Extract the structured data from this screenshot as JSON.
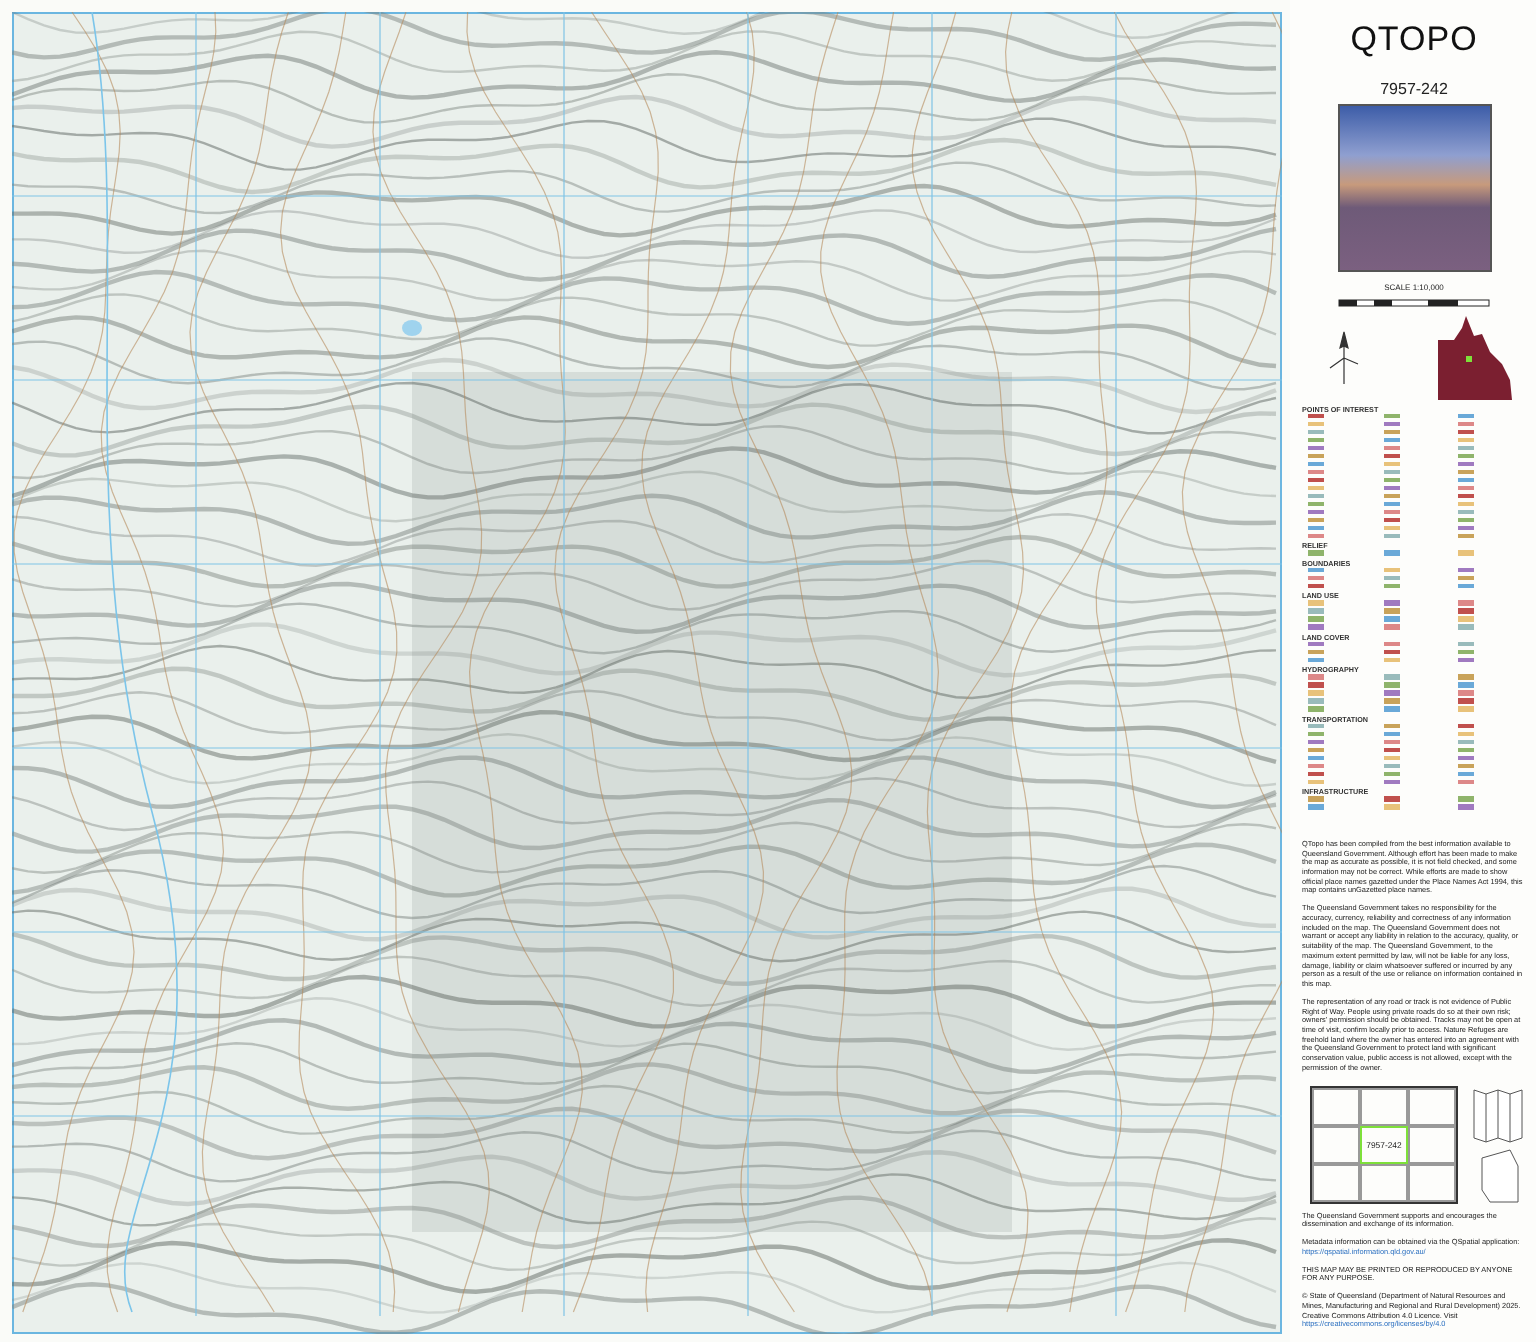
{
  "sheet": {
    "title": "QTOPO",
    "number": "7957-242",
    "scale": "SCALE 1:10,000"
  },
  "legend": [
    {
      "heading": "POINTS OF INTEREST"
    },
    {
      "heading": "RELIEF"
    },
    {
      "heading": "BOUNDARIES"
    },
    {
      "heading": "LAND USE"
    },
    {
      "heading": "LAND COVER"
    },
    {
      "heading": "HYDROGRAPHY"
    },
    {
      "heading": "TRANSPORTATION"
    },
    {
      "heading": "INFRASTRUCTURE"
    }
  ],
  "notes": [
    "QTopo has been compiled from the best information available to Queensland Government. Although effort has been made to make the map as accurate as possible, it is not field checked, and some information may not be correct. While efforts are made to show official place names gazetted under the Place Names Act 1994, this map contains unGazetted place names.",
    "The Queensland Government takes no responsibility for the accuracy, currency, reliability and correctness of any information included on the map. The Queensland Government does not warrant or accept any liability in relation to the accuracy, quality, or suitability of the map. The Queensland Government, to the maximum extent permitted by law, will not be liable for any loss, damage, liability or claim whatsoever suffered or incurred by any person as a result of the use or reliance on information contained in this map.",
    "The representation of any road or track is not evidence of Public Right of Way. People using private roads do so at their own risk; owners' permission should be obtained. Tracks may not be open at time of visit, confirm locally prior to access. Nature Refuges are freehold land where the owner has entered into an agreement with the Queensland Government to protect land with significant conservation value, public access is not allowed, except with the permission of the owner."
  ],
  "index": [
    {
      "selected": false
    },
    {
      "selected": false
    },
    {
      "selected": false
    },
    {
      "selected": false
    },
    {
      "label": "7957-242",
      "selected": true
    },
    {
      "selected": false
    },
    {
      "selected": false
    },
    {
      "selected": false
    },
    {
      "selected": false
    }
  ],
  "support": "The Queensland Government supports and encourages the dissemination and exchange of its information.",
  "metadata": {
    "text": "Metadata information can be obtained via the QSpatial application:",
    "link": "https://qspatial.information.qld.gov.au/"
  },
  "notice": "THIS MAP MAY BE PRINTED OR REPRODUCED BY ANYONE FOR ANY PURPOSE.",
  "copyright": {
    "text": "© State of Queensland (Department of Natural Resources and Mines, Manufacturing and Regional and Rural Development) 2025. Creative Commons Attribution 4.0 Licence. Visit",
    "link": "https://creativecommons.org/licenses/by/4.0"
  }
}
